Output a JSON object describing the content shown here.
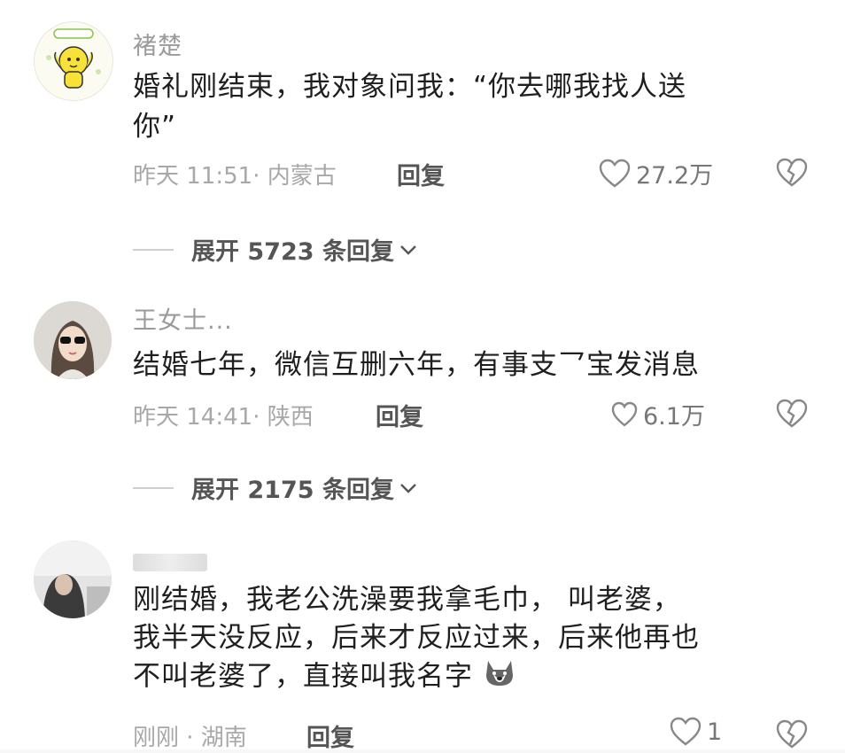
{
  "comments": [
    {
      "username": "褚楚",
      "text_lines": [
        "婚礼刚结束，我对象问我：“你去哪我找人送",
        "你”"
      ],
      "meta": "昨天 11:51· 内蒙古",
      "reply": "回复",
      "likes": "27.2万",
      "expand": "展开 5723 条回复",
      "avatar": "yellow-cartoon-avatar"
    },
    {
      "username": "王女士...",
      "text_lines": [
        "结婚七年，微信互删六年，有事支乛宝发消息"
      ],
      "meta": "昨天 14:41· 陕西",
      "reply": "回复",
      "likes": "6.1万",
      "expand": "展开 2175 条回复",
      "avatar": "woman-sunglasses-avatar"
    },
    {
      "username": "",
      "text_lines": [
        "刚结婚，我老公洗澡要我拿毛巾，   叫老婆，",
        "我半天没反应，后来才反应过来，后来他再也",
        "不叫老婆了，直接叫我名字"
      ],
      "meta": "刚刚 · 湖南",
      "reply": "回复",
      "likes": "1",
      "avatar": "photo-avatar",
      "emoji": "husky-dog-emoji"
    }
  ],
  "colors": {
    "meta": "#a8a8a8",
    "username": "#9a9a9a",
    "text": "#1f1f1f",
    "avatar_yellow": "#f8e23a"
  }
}
